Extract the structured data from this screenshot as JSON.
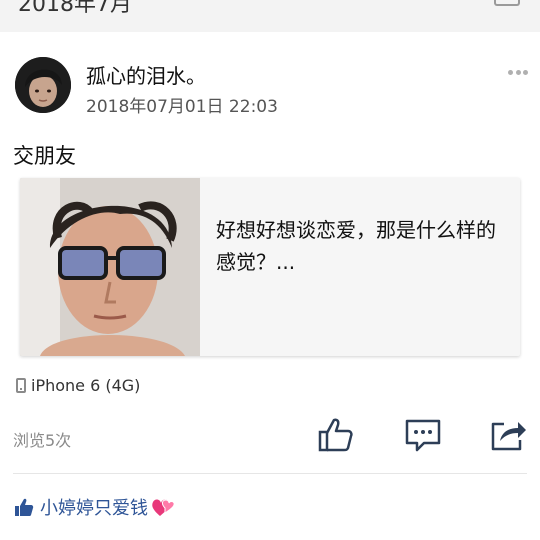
{
  "top": {
    "date_header": "2018年7月"
  },
  "post": {
    "user_name": "孤心的泪水。",
    "timestamp": "2018年07月01日 22:03",
    "text": "交朋友",
    "link_card": {
      "title": "好想好想谈恋爱，那是什么样的感觉？..."
    },
    "device": "iPhone 6 (4G)",
    "views": "浏览5次"
  },
  "likes": {
    "liked_by": "小婷婷只爱钱"
  },
  "colors": {
    "accent": "#2f5597",
    "icon_stroke": "#2d3e57",
    "muted": "#8a8a8a"
  }
}
